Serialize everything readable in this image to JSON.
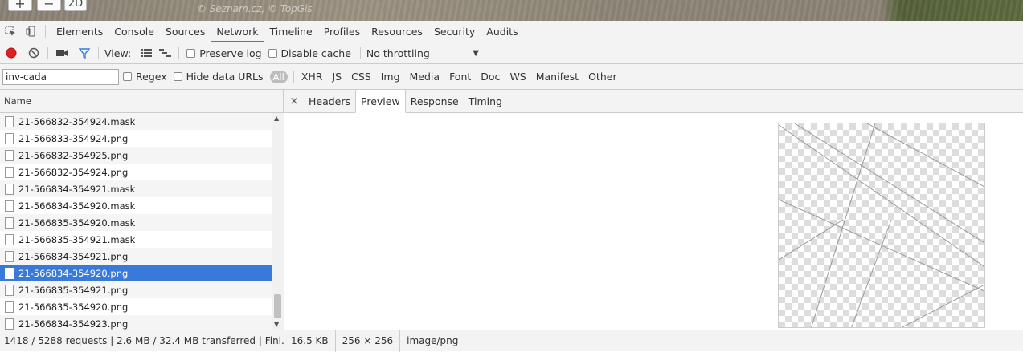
{
  "map": {
    "zoom_in_label": "+",
    "zoom_out_label": "−",
    "mode_label": "2D",
    "credit": "© Seznam.cz, © TopGis"
  },
  "devtools": {
    "tabs": [
      "Elements",
      "Console",
      "Sources",
      "Network",
      "Timeline",
      "Profiles",
      "Resources",
      "Security",
      "Audits"
    ],
    "active_tab": "Network"
  },
  "toolbar": {
    "view_label": "View:",
    "preserve_log": "Preserve log",
    "disable_cache": "Disable cache",
    "throttling": "No throttling"
  },
  "filter": {
    "value": "inv-cada",
    "regex": "Regex",
    "hide_data_urls": "Hide data URLs",
    "all": "All",
    "types": [
      "XHR",
      "JS",
      "CSS",
      "Img",
      "Media",
      "Font",
      "Doc",
      "WS",
      "Manifest",
      "Other"
    ]
  },
  "list": {
    "header": "Name",
    "rows": [
      "21-566832-354924.mask",
      "21-566833-354924.png",
      "21-566832-354925.png",
      "21-566832-354924.png",
      "21-566834-354921.mask",
      "21-566834-354920.mask",
      "21-566835-354920.mask",
      "21-566835-354921.mask",
      "21-566834-354921.png",
      "21-566834-354920.png",
      "21-566835-354921.png",
      "21-566835-354920.png",
      "21-566834-354923.png"
    ],
    "selected_index": 9
  },
  "detail": {
    "close_label": "×",
    "tabs": [
      "Headers",
      "Preview",
      "Response",
      "Timing"
    ],
    "active_tab": "Preview"
  },
  "status": {
    "summary": "1418 / 5288 requests  |  2.6 MB / 32.4 MB transferred  |  Fini...",
    "size": "16.5 KB",
    "dimensions": "256 × 256",
    "mime": "image/png"
  }
}
